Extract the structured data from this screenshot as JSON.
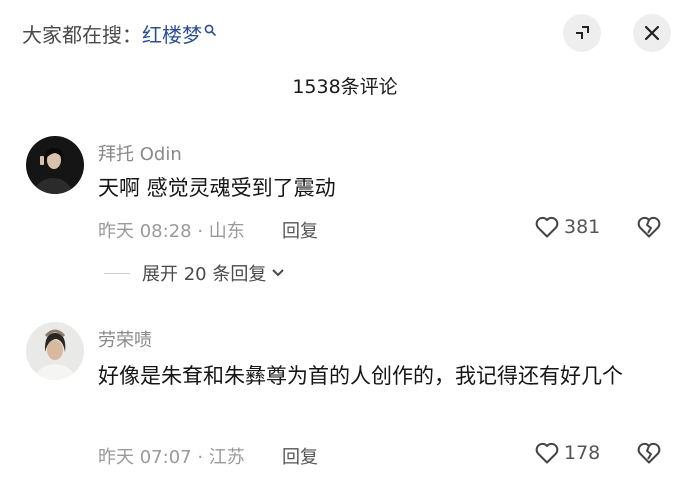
{
  "search_hint": {
    "prefix": "大家都在搜：",
    "keyword": "红楼梦"
  },
  "comments_header": {
    "title": "1538条评论"
  },
  "comments": [
    {
      "username": "拜托 Odin",
      "content": "天啊 感觉灵魂受到了震动",
      "time": "昨天 08:28 · 山东",
      "reply_label": "回复",
      "likes": "381",
      "expand_label": "展开 20 条回复"
    },
    {
      "username": "劳荣啧",
      "content": "好像是朱耷和朱彝尊为首的人创作的，我记得还有好几个",
      "time": "昨天 07:07 · 江苏",
      "reply_label": "回复",
      "likes": "178"
    }
  ],
  "colors": {
    "keyword": "#2c4f91",
    "secondary_text": "#9a9a9a",
    "button_bg": "#eeeeef"
  },
  "icons": [
    "search-icon",
    "collapse-icon",
    "close-icon",
    "heart-icon",
    "broken-heart-icon",
    "chevron-down-icon"
  ]
}
